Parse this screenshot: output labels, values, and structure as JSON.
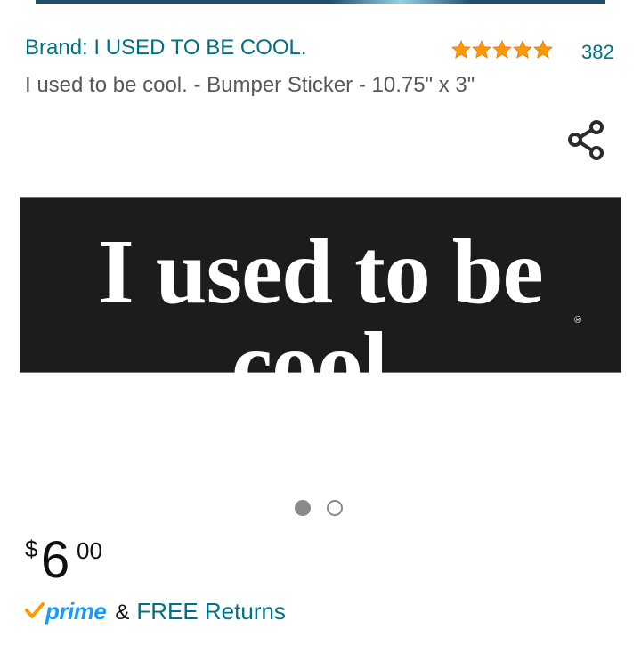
{
  "brand": {
    "label": "Brand: I USED TO BE COOL."
  },
  "rating": {
    "stars": 5,
    "count": "382"
  },
  "product": {
    "title": "I used to be cool. - Bumper Sticker - 10.75\" x 3\"",
    "image_text": "I used to be cool.",
    "image_reg_mark": "®"
  },
  "carousel": {
    "total": 2,
    "active_index": 0
  },
  "price": {
    "symbol": "$",
    "whole": "6",
    "fraction": "00"
  },
  "delivery": {
    "prime": "prime",
    "amp": "&",
    "free_returns": "FREE Returns"
  },
  "icons": {
    "share": "share-icon",
    "star": "star-icon",
    "prime_check": "check-icon"
  },
  "colors": {
    "link": "#007185",
    "star": "#ff9900",
    "prime_blue": "#1a98ff",
    "prime_check": "#ff9900"
  }
}
